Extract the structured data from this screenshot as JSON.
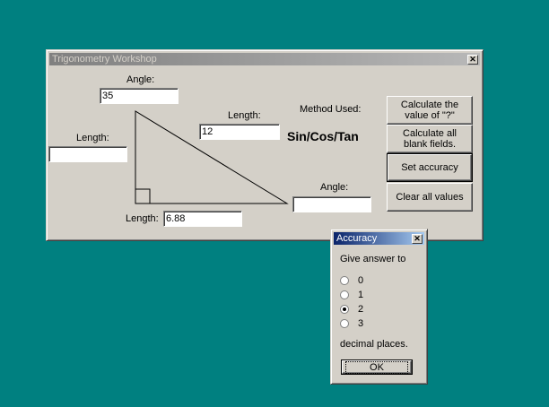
{
  "main_window": {
    "title": "Trigonometry Workshop",
    "labels": {
      "top_angle": "Angle:",
      "top_length": "Length:",
      "left_length": "Length:",
      "bottom_length": "Length:",
      "right_angle": "Angle:",
      "method_heading": "Method Used:"
    },
    "fields": {
      "top_angle": "35",
      "top_length": "12",
      "left_length": "",
      "bottom_length": "6.88",
      "right_angle": ""
    },
    "method_value": "Sin/Cos/Tan",
    "buttons": {
      "calc_unknown": "Calculate the value of \"?\"",
      "calc_blank": "Calculate all blank fields.",
      "set_accuracy": "Set accuracy",
      "clear_all": "Clear all values"
    }
  },
  "accuracy_dialog": {
    "title": "Accuracy",
    "prompt": "Give answer to",
    "options": [
      "0",
      "1",
      "2",
      "3"
    ],
    "selected": "2",
    "suffix": "decimal places.",
    "ok_label": "OK"
  }
}
